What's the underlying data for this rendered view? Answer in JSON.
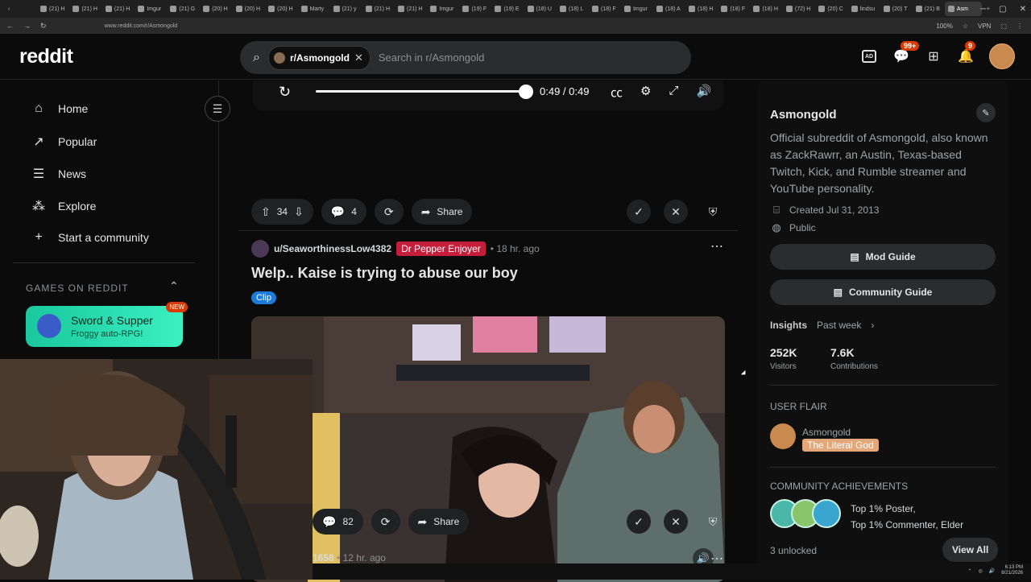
{
  "browser": {
    "tabs": [
      "(21) H",
      "(21) H",
      "(21) H",
      "Imgur",
      "(21) G",
      "(20) H",
      "(20) H",
      "(20) H",
      "Marty",
      "(21) y",
      "(21) H",
      "(21) H",
      "Imgur",
      "(19) F",
      "(19) E",
      "(18) U",
      "(18) L",
      "(18) F",
      "Imgur",
      "(18) A",
      "(18) H",
      "(18) F",
      "(18) H",
      "(72) H",
      "(20) C",
      "lindsu",
      "(20) T",
      "(21) B",
      "Asm"
    ],
    "url": "www.reddit.com/r/Asmongold",
    "zoom": "100%",
    "vpn": "VPN"
  },
  "header": {
    "logo": "reddit",
    "chip_label": "r/Asmongold",
    "search_placeholder": "Search in r/Asmongold",
    "chat_badge": "99+",
    "notif_badge": "9",
    "ad_icon_text": "AD"
  },
  "sidebar": {
    "items": [
      {
        "label": "Home",
        "icon": "home-icon"
      },
      {
        "label": "Popular",
        "icon": "popular-icon"
      },
      {
        "label": "News",
        "icon": "news-icon"
      },
      {
        "label": "Explore",
        "icon": "explore-icon"
      },
      {
        "label": "Start a community",
        "icon": "plus-icon"
      }
    ],
    "games_heading": "GAMES ON REDDIT",
    "game_title": "Sword & Supper",
    "game_sub": "Froggy auto-RPG!",
    "game_badge": "NEW"
  },
  "video_player": {
    "time": "0:49 / 0:49",
    "progress": 1.0
  },
  "post1_actions": {
    "votes": "34",
    "comments": "4",
    "share": "Share"
  },
  "post2": {
    "user": "u/SeaworthinessLow4382",
    "flair": "Dr Pepper Enjoyer",
    "time": "• 18 hr. ago",
    "title": "Welp.. Kaise is trying to abuse our boy",
    "tag": "Clip",
    "comments": "82",
    "share": "Share"
  },
  "post3": {
    "user": "1658",
    "time": "• 12 hr. ago"
  },
  "rightbar": {
    "title": "Asmongold",
    "description": "Official subreddit of Asmongold, also known as ZackRawrr, an Austin, Texas-based Twitch, Kick, and Rumble streamer and YouTube personality.",
    "created": "Created Jul 31, 2013",
    "visibility": "Public",
    "mod_guide": "Mod Guide",
    "community_guide": "Community Guide",
    "insights": "Insights",
    "insights_range": "Past week",
    "visitors_value": "252K",
    "visitors_label": "Visitors",
    "contrib_value": "7.6K",
    "contrib_label": "Contributions",
    "user_flair_heading": "USER FLAIR",
    "flair_name": "Asmongold",
    "flair_tag": "The Literal God",
    "achievements_heading": "COMMUNITY ACHIEVEMENTS",
    "achievement_1": "Top 1% Poster,",
    "achievement_2": "Top 1% Commenter, Elder",
    "unlocked": "3 unlocked",
    "view_all": "View All"
  },
  "taskbar": {
    "time": "6:13 PM",
    "date": "8/21/2026"
  },
  "colors": {
    "accent": "#d93a00",
    "game_card": "#2be0b3",
    "flair_red": "#c41e3a",
    "clip_tag": "#1c7ad9"
  }
}
